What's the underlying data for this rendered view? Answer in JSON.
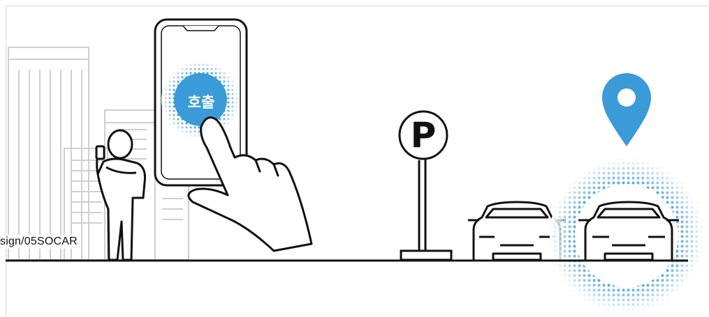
{
  "illustration": {
    "call_button_label": "호출",
    "parking_sign_letter": "P",
    "caption": "sign/05SOCAR",
    "icons": [
      "buildings",
      "person-with-phone",
      "smartphone",
      "hand-pointer-icon",
      "parking-sign-icon",
      "car-icon",
      "map-pin-icon"
    ]
  },
  "colors": {
    "accent": "#3a9bd8",
    "line": "#111111",
    "building": "#cfcfcf"
  }
}
